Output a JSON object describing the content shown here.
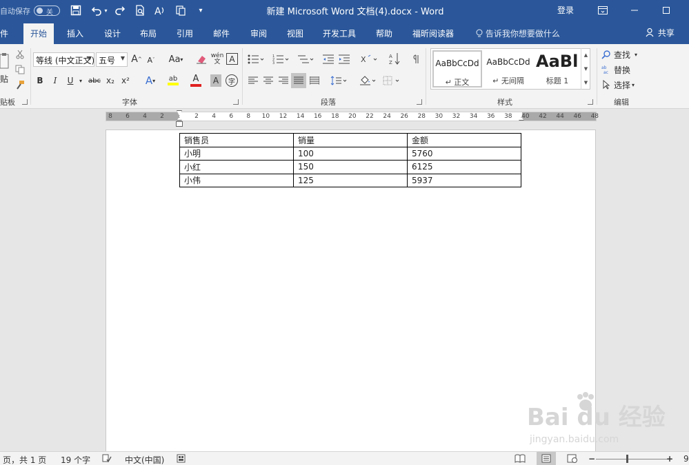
{
  "titlebar": {
    "autosave_label": "自动保存",
    "autosave_state": "关",
    "title": "新建 Microsoft Word 文档(4).docx  -  Word",
    "login": "登录"
  },
  "tabs": [
    "件",
    "开始",
    "插入",
    "设计",
    "布局",
    "引用",
    "邮件",
    "审阅",
    "视图",
    "开发工具",
    "帮助",
    "福昕阅读器"
  ],
  "tell_me": "告诉我你想要做什么",
  "share": "共享",
  "ribbon": {
    "clipboard": {
      "paste": "贴",
      "label": "贴板"
    },
    "font": {
      "name": "等线 (中文正文)",
      "size": "五号",
      "label": "字体",
      "grow": "A",
      "shrink": "A",
      "case": "Aa",
      "phonetic": "wén",
      "border_char": "A",
      "bold": "B",
      "italic": "I",
      "underline": "U",
      "strike": "abc",
      "subscript": "x₂",
      "superscript": "x²",
      "effects": "A",
      "highlight": "ab",
      "color": "A",
      "shade": "A",
      "enclose": "字"
    },
    "paragraph": {
      "label": "段落"
    },
    "styles": {
      "label": "样式",
      "items": [
        {
          "sample": "AaBbCcDd",
          "name": "↵ 正文"
        },
        {
          "sample": "AaBbCcDd",
          "name": "↵ 无间隔"
        },
        {
          "sample": "AaBl",
          "name": "标题 1"
        }
      ]
    },
    "editing": {
      "label": "编辑",
      "find": "查找",
      "replace": "替换",
      "select": "选择"
    }
  },
  "ruler": {
    "left_numbers": [
      "8",
      "6",
      "4",
      "2"
    ],
    "right_numbers": [
      "2",
      "4",
      "6",
      "8",
      "10",
      "12",
      "14",
      "16",
      "18",
      "20",
      "22",
      "24",
      "26",
      "28",
      "30",
      "32",
      "34",
      "36",
      "38",
      "40",
      "42",
      "44",
      "46",
      "48"
    ]
  },
  "table": {
    "rows": [
      [
        "销售员",
        "销量",
        "金额"
      ],
      [
        "小明",
        "100",
        "5760"
      ],
      [
        "小红",
        "150",
        "6125"
      ],
      [
        "小伟",
        "125",
        "5937"
      ]
    ]
  },
  "statusbar": {
    "page": "页，共 1 页",
    "words": "19 个字",
    "language": "中文(中国)",
    "zoom_level": "9"
  },
  "watermark": {
    "brand": "Bai du 经验",
    "url": "jingyan.baidu.com"
  }
}
